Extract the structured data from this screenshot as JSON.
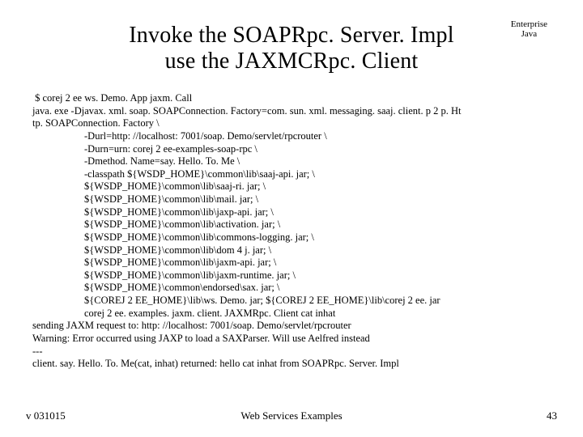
{
  "header": {
    "corner_line1": "Enterprise",
    "corner_line2": "Java"
  },
  "title": {
    "line1": "Invoke the SOAPRpc. Server. Impl",
    "line2": "use the JAXMCRpc. Client"
  },
  "code": {
    "l0": " $ corej 2 ee ws. Demo. App jaxm. Call",
    "l1": "java. exe -Djavax. xml. soap. SOAPConnection. Factory=com. sun. xml. messaging. saaj. client. p 2 p. Ht",
    "l2": "tp. SOAPConnection. Factory \\",
    "i0": "-Durl=http: //localhost: 7001/soap. Demo/servlet/rpcrouter \\",
    "i1": "-Durn=urn: corej 2 ee-examples-soap-rpc \\",
    "i2": "-Dmethod. Name=say. Hello. To. Me \\",
    "i3": "-classpath ${WSDP_HOME}\\common\\lib\\saaj-api. jar; \\",
    "i4": "${WSDP_HOME}\\common\\lib\\saaj-ri. jar; \\",
    "i5": "${WSDP_HOME}\\common\\lib\\mail. jar; \\",
    "i6": "${WSDP_HOME}\\common\\lib\\jaxp-api. jar; \\",
    "i7": "${WSDP_HOME}\\common\\lib\\activation. jar; \\",
    "i8": "${WSDP_HOME}\\common\\lib\\commons-logging. jar; \\",
    "i9": "${WSDP_HOME}\\common\\lib\\dom 4 j. jar; \\",
    "i10": "${WSDP_HOME}\\common\\lib\\jaxm-api. jar; \\",
    "i11": "${WSDP_HOME}\\common\\lib\\jaxm-runtime. jar; \\",
    "i12": "${WSDP_HOME}\\common\\endorsed\\sax. jar; \\",
    "i13": "${COREJ 2 EE_HOME}\\lib\\ws. Demo. jar; ${COREJ 2 EE_HOME}\\lib\\corej 2 ee. jar",
    "i14": "corej 2 ee. examples. jaxm. client. JAXMRpc. Client cat inhat",
    "l3": "sending JAXM request to: http: //localhost: 7001/soap. Demo/servlet/rpcrouter",
    "l4": "Warning: Error occurred using JAXP to load a SAXParser. Will use Aelfred instead",
    "l5": "---",
    "l6": "client. say. Hello. To. Me(cat, inhat) returned: hello cat inhat from SOAPRpc. Server. Impl"
  },
  "footer": {
    "left": "v 031015",
    "center": "Web Services Examples",
    "right": "43"
  }
}
